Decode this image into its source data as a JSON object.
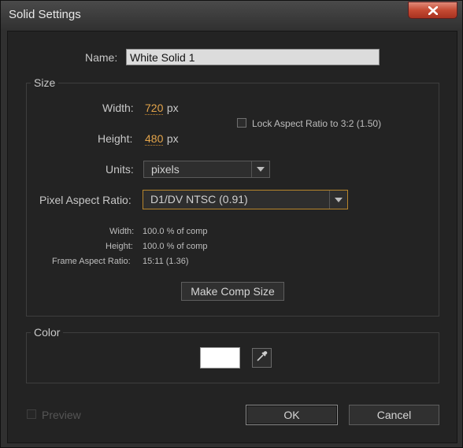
{
  "window": {
    "title": "Solid Settings",
    "close_icon": "close-icon"
  },
  "name": {
    "label": "Name:",
    "value": "White Solid 1"
  },
  "size": {
    "group_label": "Size",
    "width_label": "Width:",
    "width_value": "720",
    "width_unit": "px",
    "height_label": "Height:",
    "height_value": "480",
    "height_unit": "px",
    "lock_label": "Lock Aspect Ratio to 3:2 (1.50)",
    "units_label": "Units:",
    "units_value": "pixels",
    "par_label": "Pixel Aspect Ratio:",
    "par_value": "D1/DV NTSC (0.91)",
    "info": {
      "width_label": "Width:",
      "width_value": "100.0 % of comp",
      "height_label": "Height:",
      "height_value": "100.0 % of comp",
      "far_label": "Frame Aspect Ratio:",
      "far_value": "15:11 (1.36)"
    },
    "make_comp_size": "Make Comp Size"
  },
  "color": {
    "group_label": "Color",
    "swatch_color": "#ffffff",
    "eyedropper_icon": "eyedropper-icon"
  },
  "footer": {
    "preview_label": "Preview",
    "ok_label": "OK",
    "cancel_label": "Cancel"
  },
  "colors": {
    "accent": "#e3a44a",
    "background": "#232323",
    "close": "#c44a33"
  }
}
